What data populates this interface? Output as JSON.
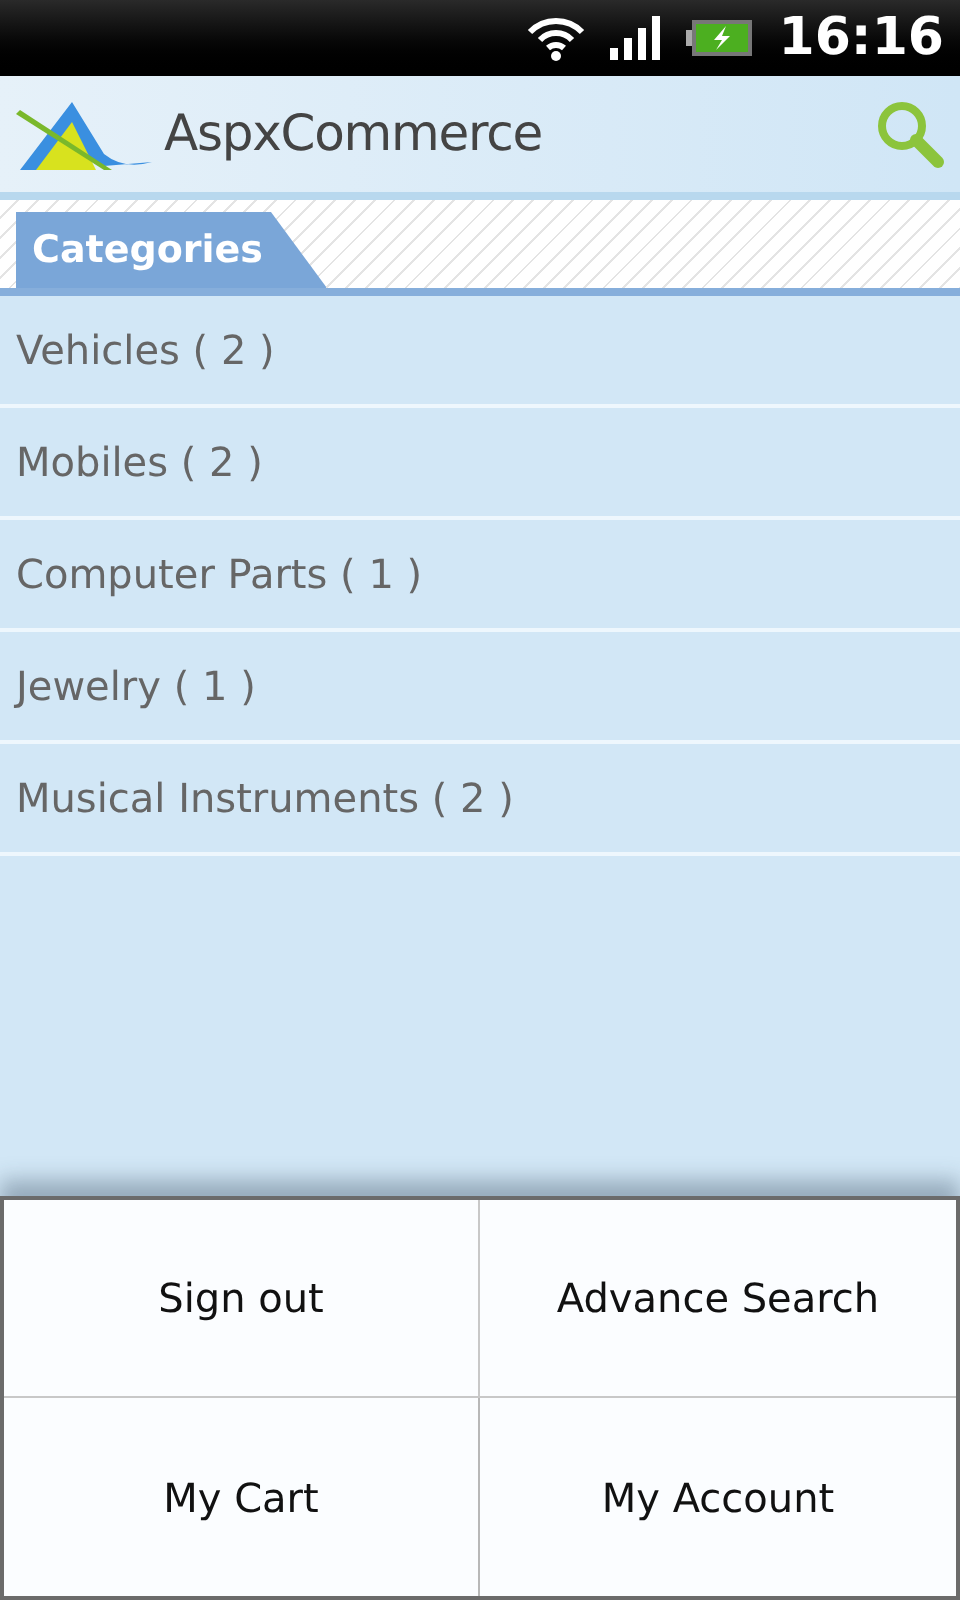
{
  "status_bar": {
    "time": "16:16"
  },
  "header": {
    "logo_text": "AspxCommerce"
  },
  "section": {
    "title": "Categories"
  },
  "categories": [
    {
      "label": "Vehicles ( 2 )"
    },
    {
      "label": "Mobiles ( 2 )"
    },
    {
      "label": "Computer Parts ( 1 )"
    },
    {
      "label": "Jewelry ( 1 )"
    },
    {
      "label": "Musical Instruments ( 2 )"
    }
  ],
  "menu": [
    {
      "label": "Sign out"
    },
    {
      "label": "Advance Search"
    },
    {
      "label": "My Cart"
    },
    {
      "label": "My Account"
    }
  ]
}
